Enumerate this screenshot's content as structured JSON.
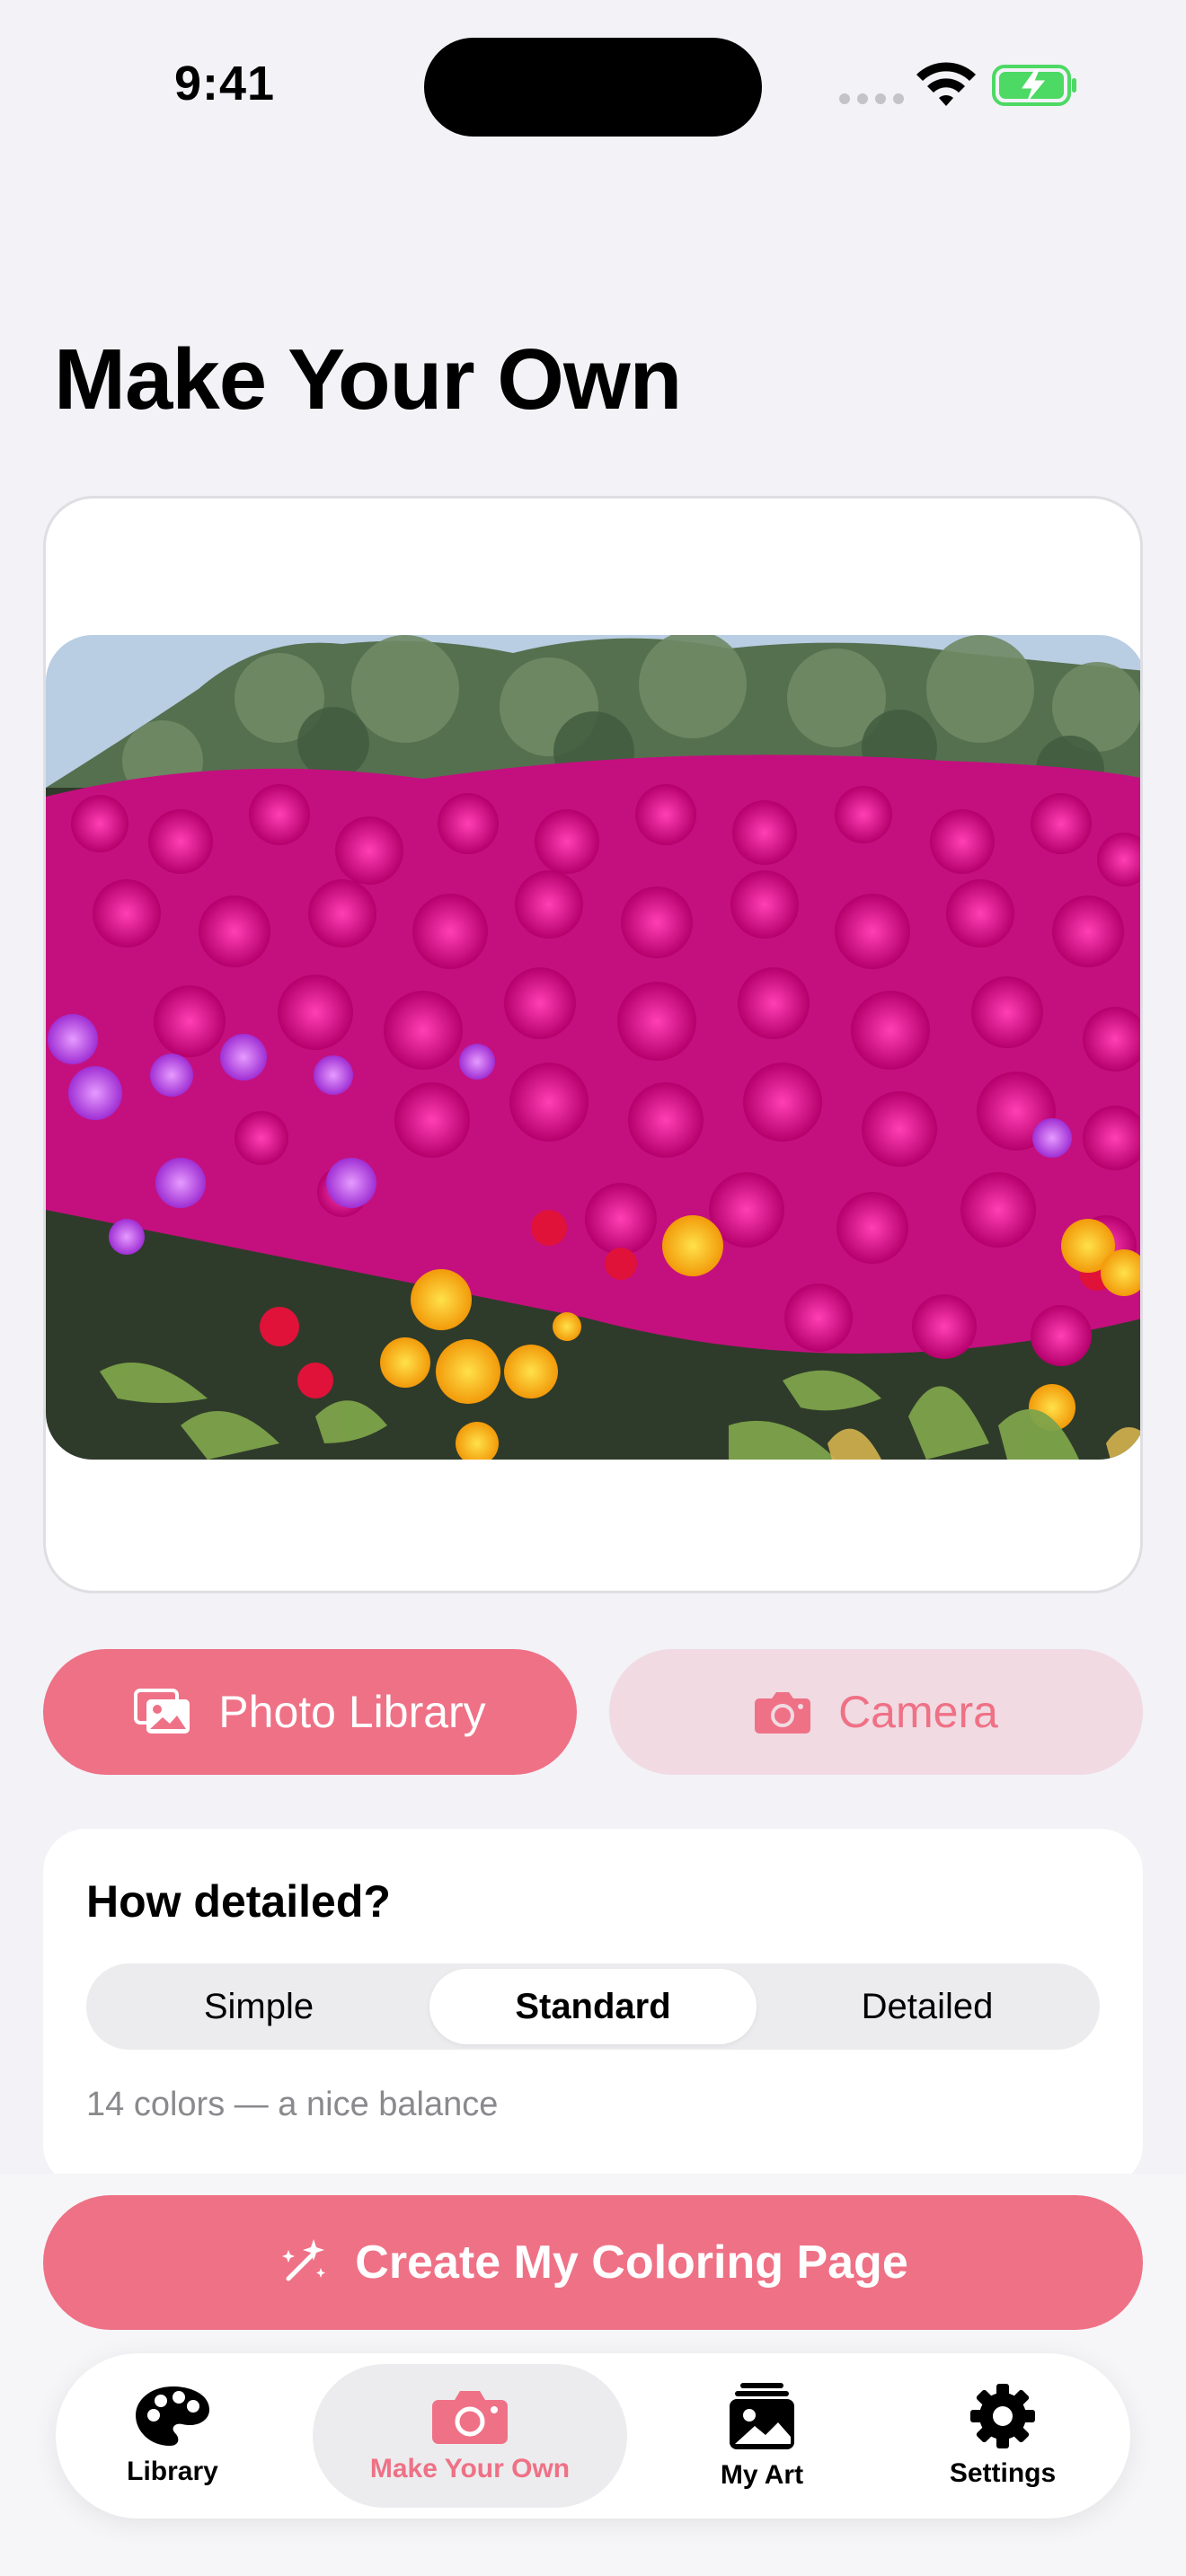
{
  "status_bar": {
    "time": "9:41"
  },
  "page_title": "Make Your Own",
  "photo": {
    "subject": "field of magenta and purple ice plant flowers with yellow flowers and green shrubs"
  },
  "source_buttons": {
    "photo_library": {
      "label": "Photo Library",
      "icon": "photo-library-icon"
    },
    "camera": {
      "label": "Camera",
      "icon": "camera-icon"
    }
  },
  "detail": {
    "title": "How detailed?",
    "options": [
      "Simple",
      "Standard",
      "Detailed"
    ],
    "selected": "Standard",
    "caption": "14 colors — a nice balance"
  },
  "create_button": {
    "label": "Create My Coloring Page",
    "icon": "magic-wand-icon"
  },
  "tab_bar": {
    "items": [
      {
        "label": "Library",
        "icon": "palette-icon",
        "selected": false
      },
      {
        "label": "Make Your Own",
        "icon": "camera-icon",
        "selected": true
      },
      {
        "label": "My Art",
        "icon": "photo-stack-icon",
        "selected": false
      },
      {
        "label": "Settings",
        "icon": "gear-icon",
        "selected": false
      }
    ]
  },
  "colors": {
    "accent": "#ef7186",
    "accent_light": "#f1dae2",
    "background": "#f2f2f7"
  }
}
